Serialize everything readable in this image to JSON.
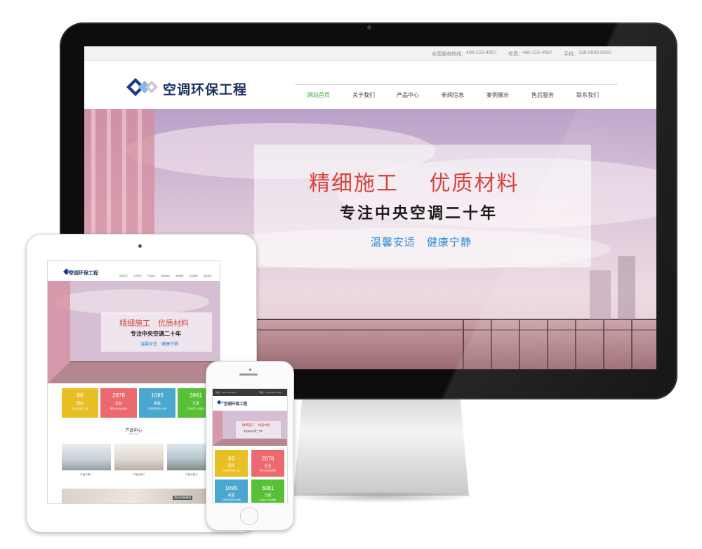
{
  "desktop": {
    "topbar": {
      "hotline_label": "全国服务热线：",
      "hotline": "400-123-4567",
      "fax_label": "传真：",
      "fax": "+86-123-4567",
      "mobile_label": "手机：",
      "mobile": "138 0000 0000"
    },
    "logo": {
      "text": "空调环保工程"
    },
    "nav": [
      "网站首页",
      "关于我们",
      "产品中心",
      "新闻信息",
      "案例展示",
      "售后服务",
      "联系我们"
    ],
    "hero": {
      "line1": "精细施工　 优质材料",
      "line2": "专注中央空调二十年",
      "line3": "温馨安适　健康宁静"
    }
  },
  "tablet": {
    "logo": {
      "text": "空调环保工程"
    },
    "nav": [
      "网站首页",
      "关于我们",
      "产品中心",
      "新闻信息",
      "案例展示",
      "售后服务",
      "联系我们"
    ],
    "hero": {
      "line1": "精细施工　优质材料",
      "line2": "专注中央空调二十年",
      "line3": "温馨安适　健康宁静"
    },
    "stats": [
      {
        "value": "86",
        "label": "团队",
        "sub": "专业服务团队人数",
        "color": "#e8c025"
      },
      {
        "value": "2878",
        "label": "企业",
        "sub": "服务过的企业数量",
        "color": "#ec6a6f"
      },
      {
        "value": "1095",
        "label": "家庭",
        "sub": "已服务家庭用户数量",
        "color": "#4aa8cf"
      },
      {
        "value": "3981",
        "label": "方案",
        "sub": "定制施工方案数量",
        "color": "#58c035"
      }
    ],
    "products": {
      "title": "产品中心",
      "subtitle": "PRODUCT",
      "items": [
        "产品示例一",
        "产品示例二",
        "产品示例三"
      ]
    },
    "row2_label": "酒店安装通道"
  },
  "phone": {
    "topbar": {
      "left": "热线：400-123-4567",
      "right": "手机：138 0000 0000"
    },
    "logo": {
      "text": "空调环保工程"
    },
    "hero": {
      "line1": "精细施工　优质材料",
      "line2": "专注中央空调二十年"
    },
    "stats": [
      {
        "value": "86",
        "label": "团队",
        "sub": "专业服务团队人数",
        "color": "#e8c025"
      },
      {
        "value": "2878",
        "label": "企业",
        "sub": "服务过的企业数量",
        "color": "#ec6a6f"
      },
      {
        "value": "1095",
        "label": "家庭",
        "sub": "已服务家庭用户数量",
        "color": "#4aa8cf"
      },
      {
        "value": "3981",
        "label": "方案",
        "sub": "定制施工方案数量",
        "color": "#58c035"
      }
    ]
  },
  "colors": {
    "brand_navy": "#1d3463",
    "nav_active": "#3aaa35",
    "hero_red": "#d6443a",
    "hero_blue": "#2a8bd6"
  }
}
